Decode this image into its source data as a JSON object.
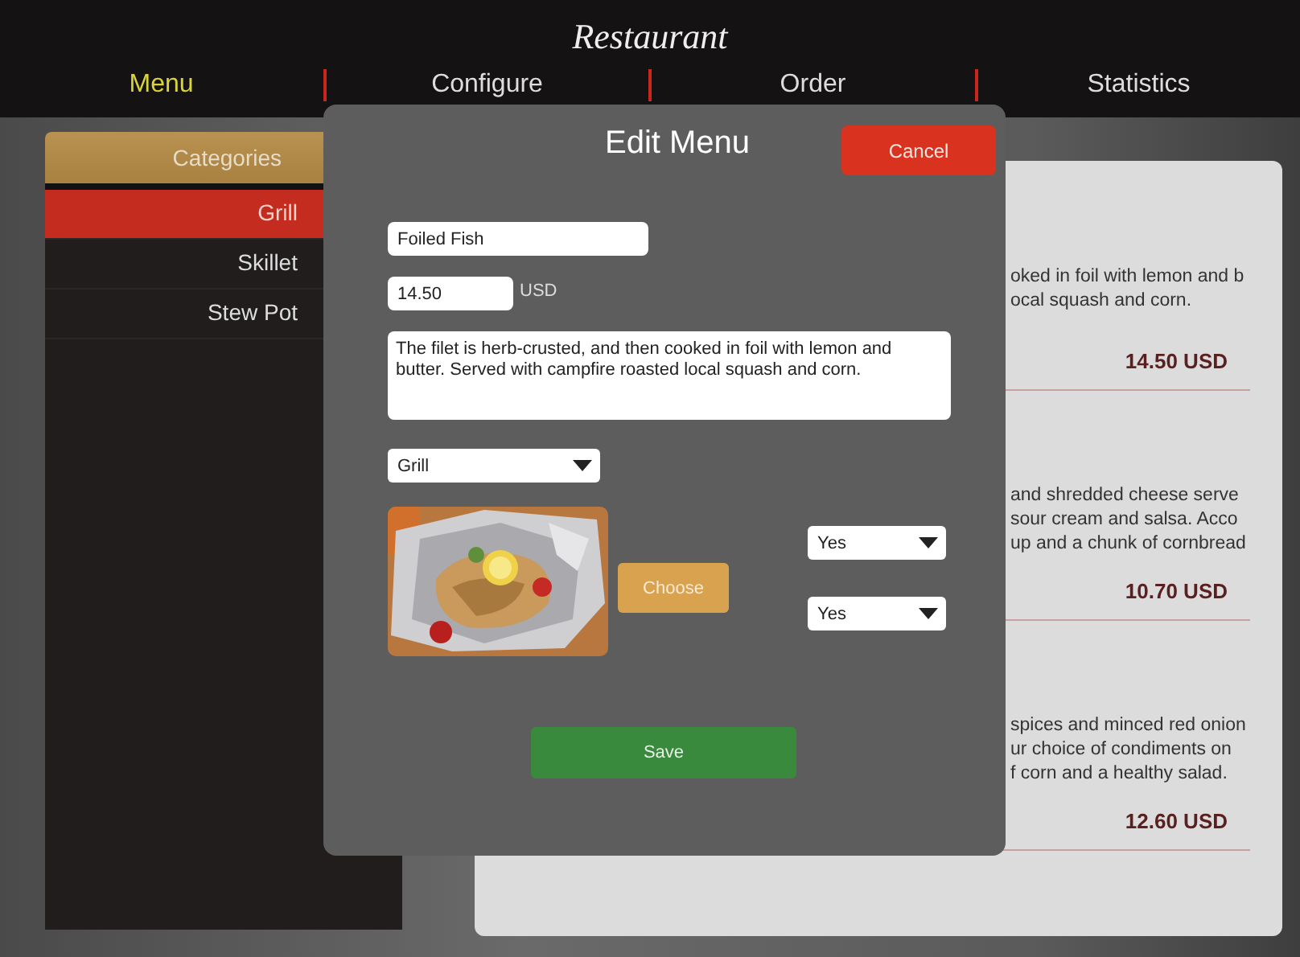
{
  "app": {
    "title": "Restaurant"
  },
  "tabs": [
    {
      "label": "Menu",
      "selected": true
    },
    {
      "label": "Configure",
      "selected": false
    },
    {
      "label": "Order",
      "selected": false
    },
    {
      "label": "Statistics",
      "selected": false
    }
  ],
  "categories": {
    "header": "Categories",
    "items": [
      {
        "label": "Grill",
        "selected": true
      },
      {
        "label": "Skillet",
        "selected": false
      },
      {
        "label": "Stew Pot",
        "selected": false
      }
    ]
  },
  "menu_items": [
    {
      "description_lines": [
        "oked in foil with lemon and b",
        "ocal squash and corn."
      ],
      "price": "14.50 USD"
    },
    {
      "description_lines": [
        "and shredded cheese serve",
        "sour cream and salsa. Acco",
        "up and a chunk of cornbread"
      ],
      "price": "10.70 USD"
    },
    {
      "description_lines": [
        "spices and minced red onion",
        "ur choice of condiments on",
        "f corn and a healthy salad."
      ],
      "price": "12.60 USD"
    }
  ],
  "dialog": {
    "title": "Edit Menu",
    "cancel": "Cancel",
    "name": "Foiled Fish",
    "price": "14.50",
    "currency": "USD",
    "description": "The filet is herb-crusted, and then cooked in foil with lemon and butter. Served with campfire roasted local squash and corn.",
    "category": "Grill",
    "choose": "Choose",
    "option_1": "Yes",
    "option_2": "Yes",
    "save": "Save"
  }
}
